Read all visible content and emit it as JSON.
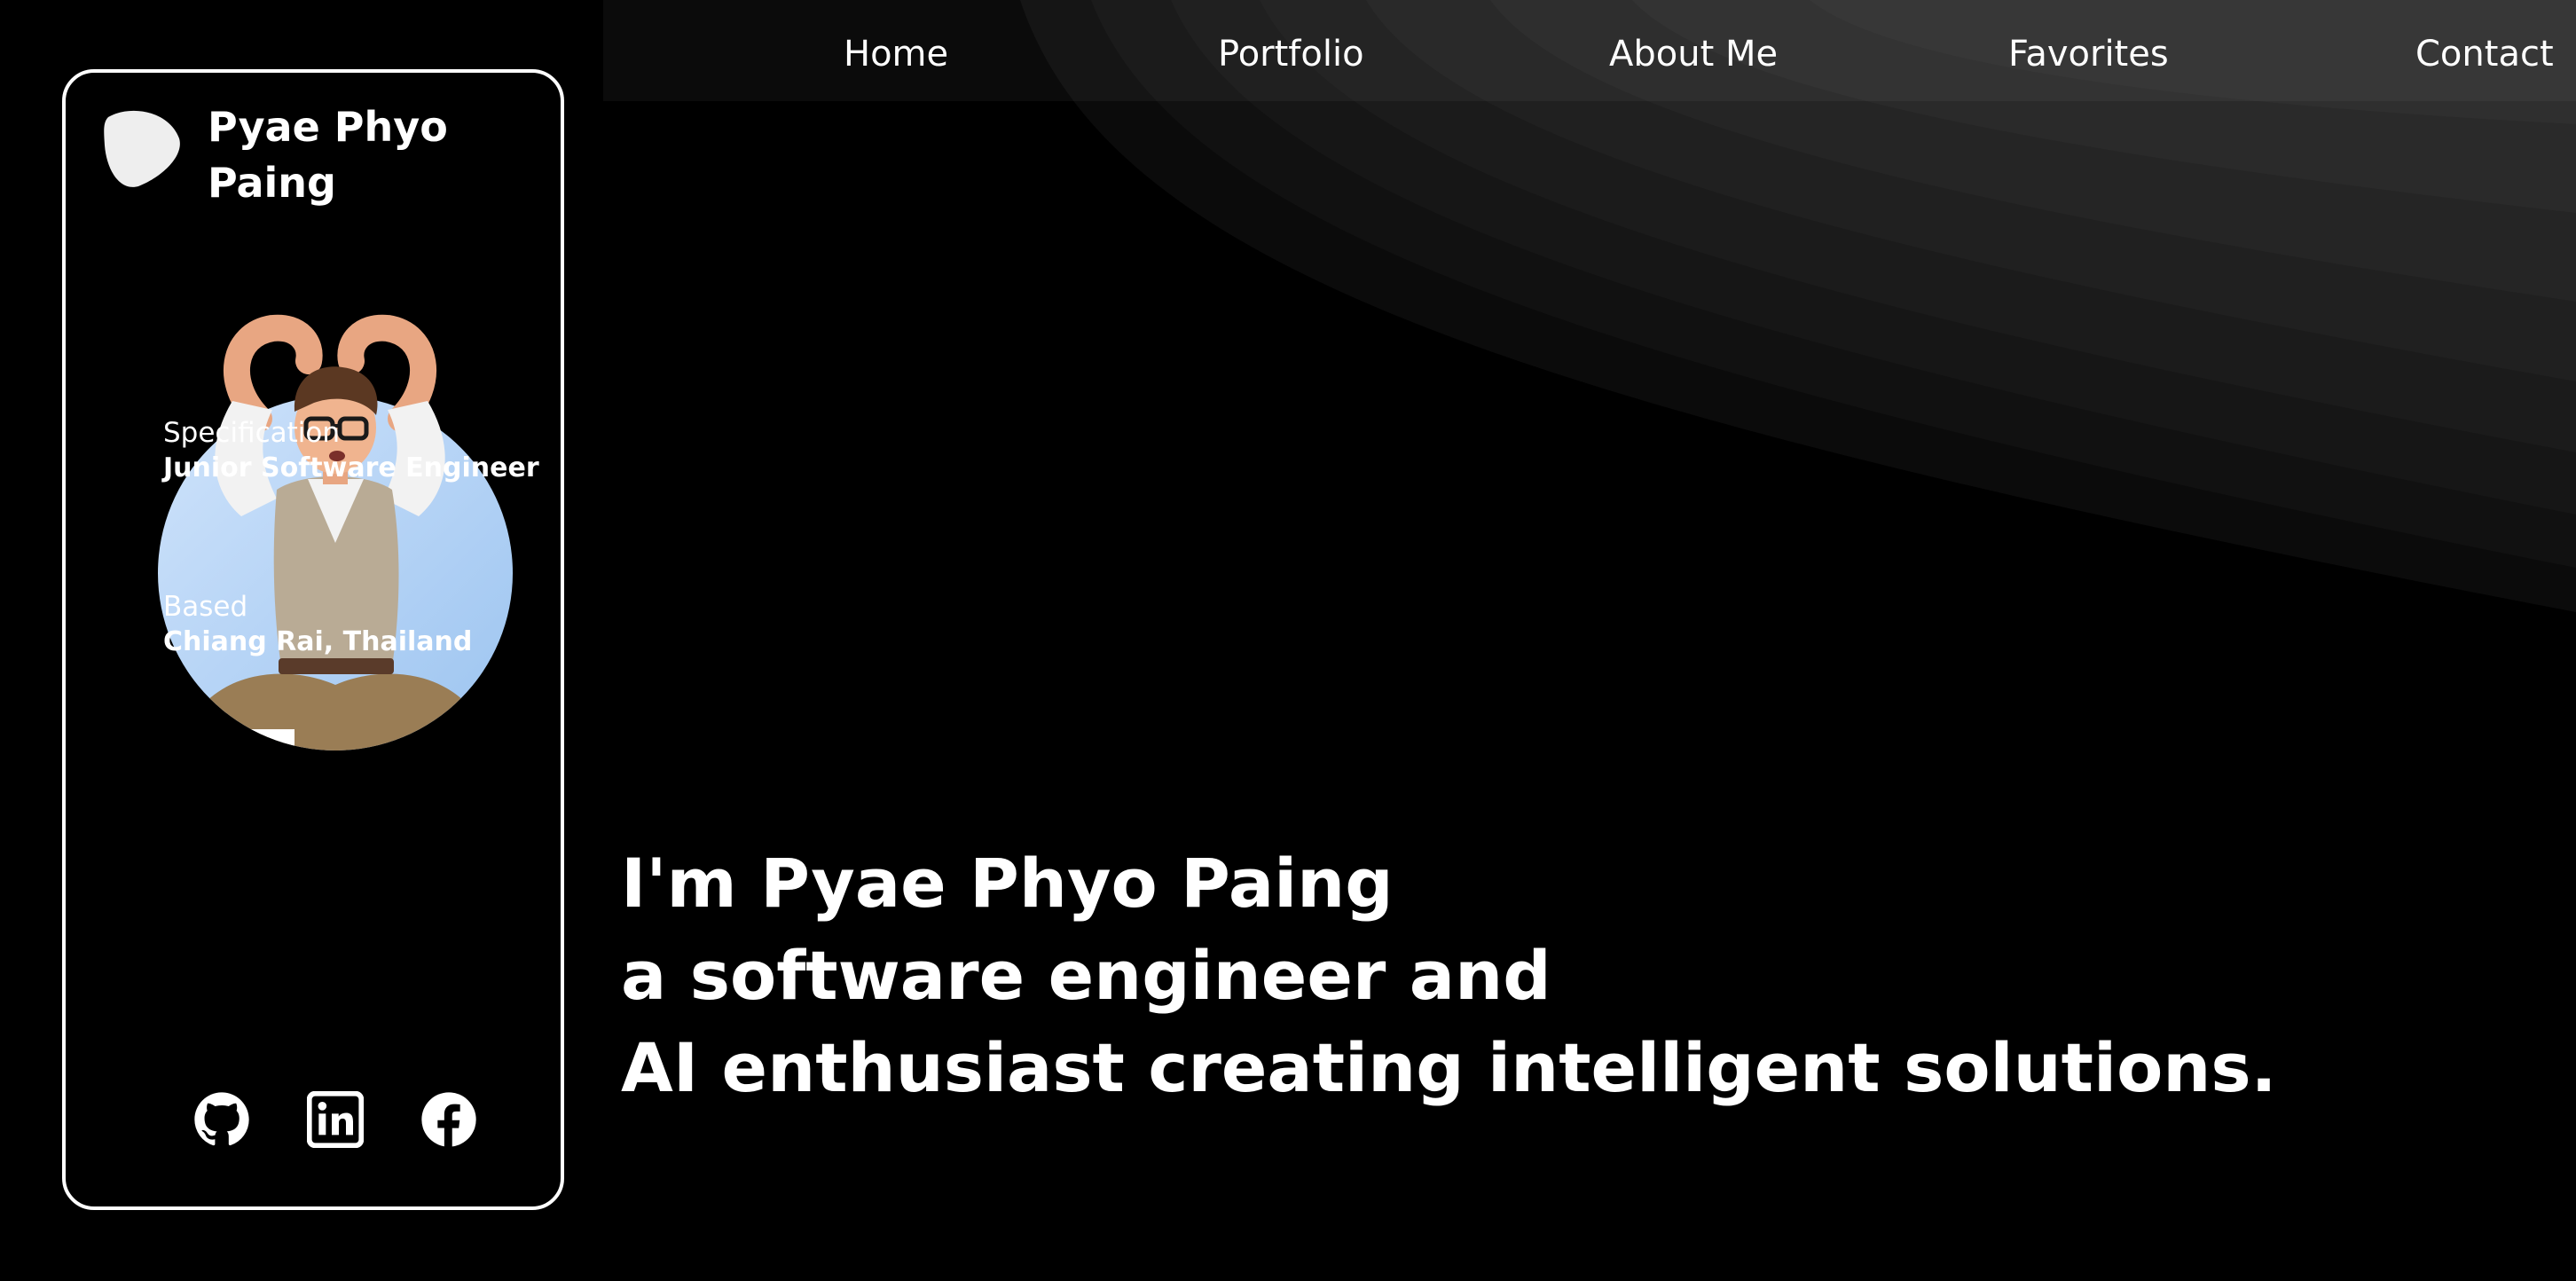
{
  "nav": {
    "home": "Home",
    "portfolio": "Portfolio",
    "about": "About Me",
    "favorites": "Favorites",
    "contact": "Contact"
  },
  "card": {
    "name_line1": "Pyae Phyo",
    "name_line2": "Paing",
    "specification_label": "Specification",
    "specification_value": "Junior Software Engineer",
    "based_label": "Based",
    "based_value": "Chiang Rai, Thailand",
    "social_icons": [
      "github-icon",
      "linkedin-icon",
      "facebook-icon"
    ]
  },
  "hero": {
    "line1": "I'm Pyae Phyo Paing",
    "line2": "a software engineer and",
    "line3": "AI enthusiast creating intelligent solutions."
  },
  "colors": {
    "background": "#000000",
    "text": "#ffffff",
    "avatar_circle": "#b9d6f6"
  }
}
